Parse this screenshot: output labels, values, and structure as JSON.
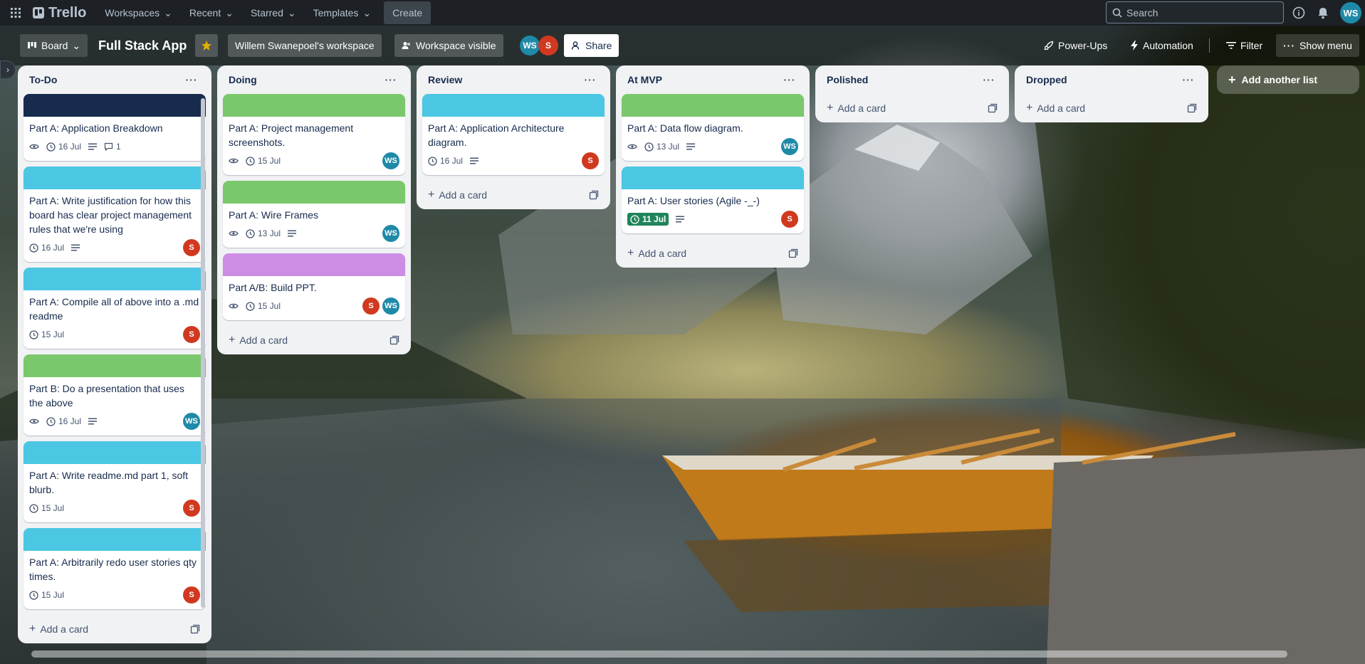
{
  "topbar": {
    "logo": "Trello",
    "nav": [
      "Workspaces",
      "Recent",
      "Starred",
      "Templates"
    ],
    "create": "Create",
    "search_placeholder": "Search",
    "user_initials": "WS"
  },
  "board": {
    "view": "Board",
    "title": "Full Stack App",
    "workspace": "Willem Swanepoel's workspace",
    "visibility": "Workspace visible",
    "members": [
      "WS",
      "S"
    ],
    "share": "Share",
    "powerups": "Power-Ups",
    "automation": "Automation",
    "filter": "Filter",
    "show_menu": "Show menu",
    "add_list": "Add another list",
    "add_card": "Add a card"
  },
  "lists": [
    {
      "title": "To-Do",
      "cards": [
        {
          "cover": "#172b4d",
          "title": "Part A: Application Breakdown",
          "watch": true,
          "due": "16 Jul",
          "desc": true,
          "comments": "1",
          "members": []
        },
        {
          "cover": "#4bc7e3",
          "title": "Part A: Write justification for how this board has clear project management rules that we're using",
          "watch": false,
          "due": "16 Jul",
          "desc": true,
          "members": [
            "S"
          ]
        },
        {
          "cover": "#4bc7e3",
          "title": "Part A: Compile all of above into a .md readme",
          "watch": false,
          "due": "15 Jul",
          "desc": false,
          "members": [
            "S"
          ]
        },
        {
          "cover": "#7bc86c",
          "title": "Part B: Do a presentation that uses the above",
          "watch": true,
          "due": "16 Jul",
          "desc": true,
          "members": [
            "WS"
          ]
        },
        {
          "cover": "#4bc7e3",
          "title": "Part A: Write readme.md part 1, soft blurb.",
          "watch": false,
          "due": "15 Jul",
          "desc": false,
          "members": [
            "S"
          ]
        },
        {
          "cover": "#4bc7e3",
          "title": "Part A: Arbitrarily redo user stories qty times.",
          "watch": false,
          "due": "15 Jul",
          "desc": false,
          "members": [
            "S"
          ]
        }
      ]
    },
    {
      "title": "Doing",
      "cards": [
        {
          "cover": "#7bc86c",
          "title": "Part A: Project management screenshots.",
          "watch": true,
          "due": "15 Jul",
          "desc": false,
          "members": [
            "WS"
          ]
        },
        {
          "cover": "#7bc86c",
          "title": "Part A: Wire Frames",
          "watch": true,
          "due": "13 Jul",
          "desc": true,
          "members": [
            "WS"
          ]
        },
        {
          "cover": "#cd8de5",
          "title": "Part A/B: Build PPT.",
          "watch": true,
          "due": "15 Jul",
          "desc": false,
          "members": [
            "S",
            "WS"
          ]
        }
      ]
    },
    {
      "title": "Review",
      "cards": [
        {
          "cover": "#4bc7e3",
          "title": "Part A: Application Architecture diagram.",
          "watch": false,
          "due": "16 Jul",
          "desc": true,
          "members": [
            "S"
          ]
        }
      ]
    },
    {
      "title": "At MVP",
      "cards": [
        {
          "cover": "#7bc86c",
          "title": "Part A: Data flow diagram.",
          "watch": true,
          "due": "13 Jul",
          "desc": true,
          "members": [
            "WS"
          ]
        },
        {
          "cover": "#4bc7e3",
          "title": "Part A: User stories (Agile -_-)",
          "watch": false,
          "due": "11 Jul",
          "due_complete": true,
          "desc": true,
          "members": [
            "S"
          ]
        }
      ]
    },
    {
      "title": "Polished",
      "cards": []
    },
    {
      "title": "Dropped",
      "cards": []
    }
  ]
}
